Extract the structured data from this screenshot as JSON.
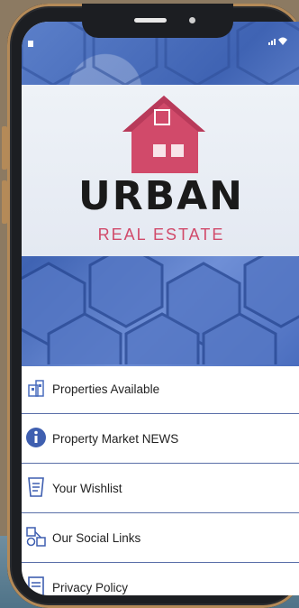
{
  "brand": {
    "title": "URBAN",
    "subtitle": "REAL ESTATE",
    "colors": {
      "accent": "#d14a6a",
      "hex_blue": "#4a6dbe",
      "divider": "#5a6fa8",
      "frame_gold": "#b48a58"
    }
  },
  "menu": {
    "items": [
      {
        "label": "Properties Available",
        "icon": "building-icon"
      },
      {
        "label": "Property Market NEWS",
        "icon": "info-icon"
      },
      {
        "label": "Your Wishlist",
        "icon": "wishlist-icon"
      },
      {
        "label": "Our Social Links",
        "icon": "social-icon"
      },
      {
        "label": "Privacy Policy",
        "icon": "document-icon"
      }
    ]
  }
}
